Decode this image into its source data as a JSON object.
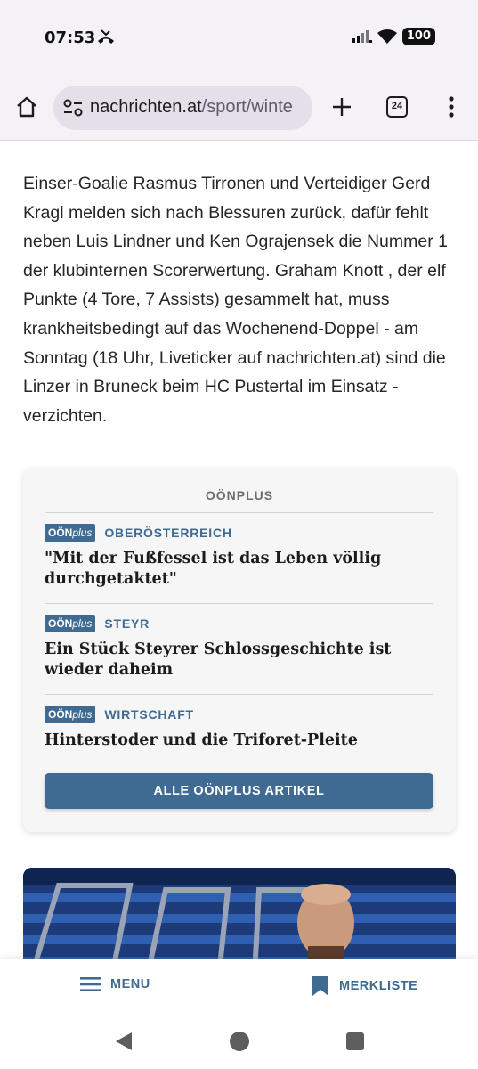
{
  "status_bar": {
    "time": "07:53",
    "battery": "100",
    "icons": [
      "missed-call-icon",
      "signal-icon",
      "wifi-icon",
      "battery-icon"
    ]
  },
  "browser": {
    "url_host": "nachrichten.at",
    "url_path": "/sport/winte",
    "tab_count": "24",
    "icons": [
      "home-icon",
      "site-settings-icon",
      "new-tab-icon",
      "tabs-icon",
      "more-icon"
    ]
  },
  "article": {
    "paragraph": "Einser-Goalie Rasmus Tirronen und Verteidiger Gerd Kragl melden sich nach Blessuren zurück, dafür fehlt neben Luis Lindner und Ken Ograjensek die Nummer 1 der klubinternen Scorerwertung. Graham Knott , der elf Punkte (4 Tore, 7 Assists) gesammelt hat, muss krankheitsbedingt auf das Wochenend-Doppel - am Sonntag (18 Uhr, Liveticker auf nachrichten.at) sind die Linzer in Bruneck beim HC Pustertal im Einsatz - verzichten."
  },
  "plus_box": {
    "title": "OÖNPLUS",
    "logo_strong": "OÖN",
    "logo_italic": "plus",
    "items": [
      {
        "category": "OBERÖSTERREICH",
        "headline": "\"Mit der Fußfessel ist das Leben völlig durchgetaktet\""
      },
      {
        "category": "STEYR",
        "headline": "Ein Stück Steyrer Schlossgeschichte ist wieder daheim"
      },
      {
        "category": "WIRTSCHAFT",
        "headline": "Hinterstoder und die Triforet-Pleite"
      }
    ],
    "button_label": "ALLE OÖNPLUS ARTIKEL"
  },
  "bottom_nav": {
    "menu_label": "MENU",
    "bookmark_label": "MERKLISTE"
  },
  "colors": {
    "accent": "#3f6a92",
    "browser_bar": "#f4f2f7",
    "url_pill": "#e3e0e9"
  }
}
